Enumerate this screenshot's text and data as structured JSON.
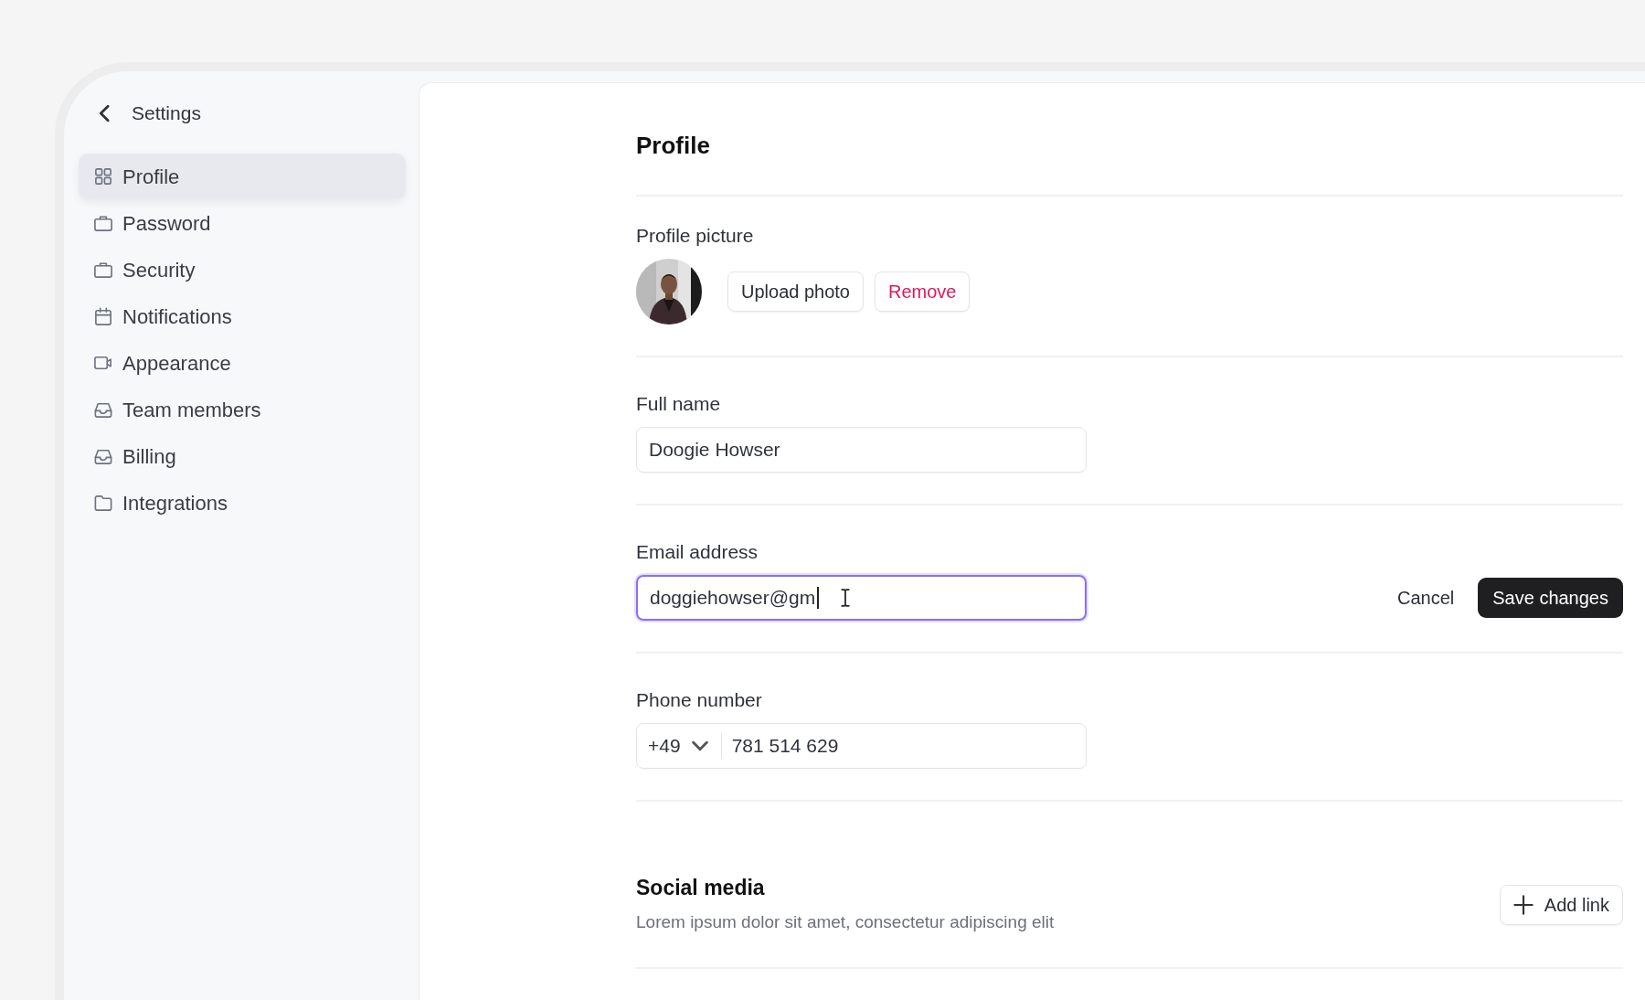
{
  "sidebar": {
    "title": "Settings",
    "items": [
      {
        "label": "Profile",
        "kind": "grid",
        "selected": true
      },
      {
        "label": "Password",
        "kind": "briefcase",
        "selected": false
      },
      {
        "label": "Security",
        "kind": "briefcase",
        "selected": false
      },
      {
        "label": "Notifications",
        "kind": "calendar",
        "selected": false
      },
      {
        "label": "Appearance",
        "kind": "video",
        "selected": false
      },
      {
        "label": "Team members",
        "kind": "inbox",
        "selected": false
      },
      {
        "label": "Billing",
        "kind": "inbox",
        "selected": false
      },
      {
        "label": "Integrations",
        "kind": "folder",
        "selected": false
      }
    ]
  },
  "main": {
    "title": "Profile",
    "profile_picture": {
      "label": "Profile picture",
      "upload_button": "Upload photo",
      "remove_button": "Remove"
    },
    "full_name": {
      "label": "Full name",
      "value": "Doogie Howser",
      "focused": false
    },
    "email": {
      "label": "Email address",
      "value": "doggiehowser@gm",
      "focused": true
    },
    "actions": {
      "cancel": "Cancel",
      "save": "Save changes"
    },
    "phone": {
      "label": "Phone number",
      "country_code": "+49",
      "number": "781 514 629"
    },
    "social_media": {
      "title": "Social media",
      "description": "Lorem ipsum dolor sit amet, consectetur adipiscing elit",
      "add_button": "Add link"
    }
  }
}
